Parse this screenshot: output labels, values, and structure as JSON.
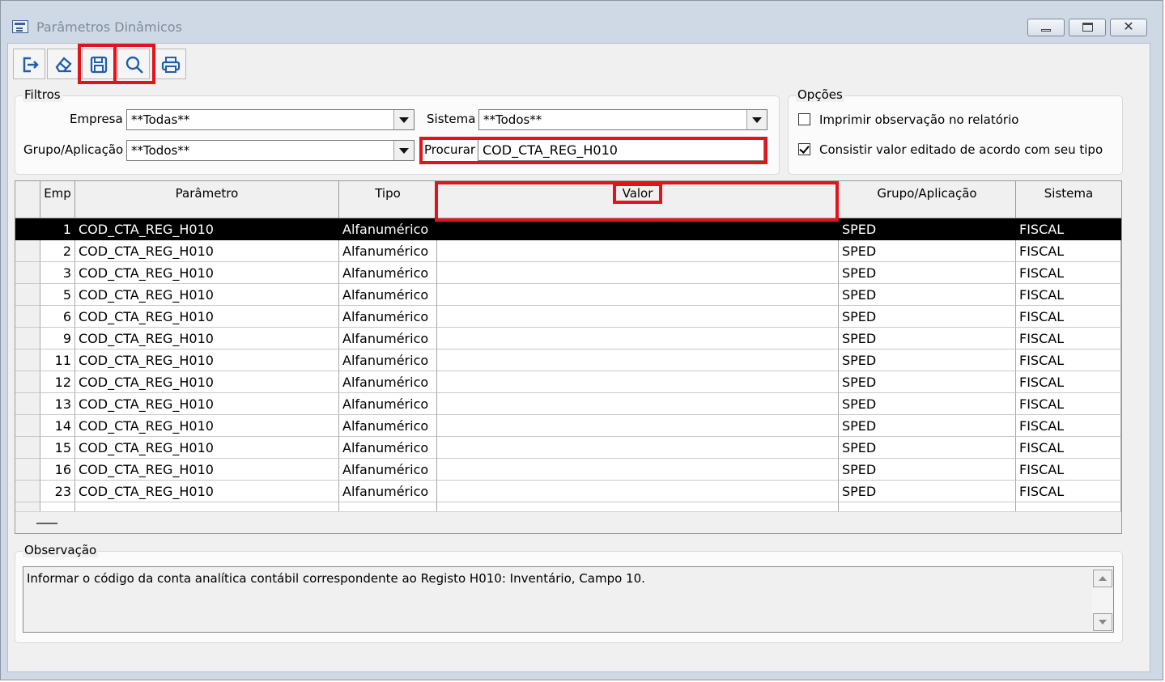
{
  "window": {
    "title": "Parâmetros Dinâmicos",
    "close_glyph": "✕"
  },
  "toolbar": {
    "buttons": [
      {
        "icon": "exit-icon"
      },
      {
        "icon": "eraser-icon"
      },
      {
        "icon": "save-icon"
      },
      {
        "icon": "search-icon"
      },
      {
        "icon": "printer-icon"
      }
    ]
  },
  "filters": {
    "legend": "Filtros",
    "empresa_label": "Empresa",
    "empresa_value": "**Todas**",
    "sistema_label": "Sistema",
    "sistema_value": "**Todos**",
    "grupo_label": "Grupo/Aplicação",
    "grupo_value": "**Todos**",
    "procurar_label": "Procurar",
    "procurar_value": "COD_CTA_REG_H010"
  },
  "options": {
    "legend": "Opções",
    "imprimir_label": "Imprimir observação no relatório",
    "imprimir_checked": false,
    "consistir_label": "Consistir valor editado de acordo com seu tipo",
    "consistir_checked": true
  },
  "grid": {
    "columns": [
      "Emp",
      "Parâmetro",
      "Tipo",
      "Valor",
      "Grupo/Aplicação",
      "Sistema"
    ],
    "selected_row": 0,
    "rows": [
      {
        "emp": "1",
        "parametro": "COD_CTA_REG_H010",
        "tipo": "Alfanumérico",
        "valor": "",
        "grupo": "SPED",
        "sistema": "FISCAL"
      },
      {
        "emp": "2",
        "parametro": "COD_CTA_REG_H010",
        "tipo": "Alfanumérico",
        "valor": "",
        "grupo": "SPED",
        "sistema": "FISCAL"
      },
      {
        "emp": "3",
        "parametro": "COD_CTA_REG_H010",
        "tipo": "Alfanumérico",
        "valor": "",
        "grupo": "SPED",
        "sistema": "FISCAL"
      },
      {
        "emp": "5",
        "parametro": "COD_CTA_REG_H010",
        "tipo": "Alfanumérico",
        "valor": "",
        "grupo": "SPED",
        "sistema": "FISCAL"
      },
      {
        "emp": "6",
        "parametro": "COD_CTA_REG_H010",
        "tipo": "Alfanumérico",
        "valor": "",
        "grupo": "SPED",
        "sistema": "FISCAL"
      },
      {
        "emp": "9",
        "parametro": "COD_CTA_REG_H010",
        "tipo": "Alfanumérico",
        "valor": "",
        "grupo": "SPED",
        "sistema": "FISCAL"
      },
      {
        "emp": "11",
        "parametro": "COD_CTA_REG_H010",
        "tipo": "Alfanumérico",
        "valor": "",
        "grupo": "SPED",
        "sistema": "FISCAL"
      },
      {
        "emp": "12",
        "parametro": "COD_CTA_REG_H010",
        "tipo": "Alfanumérico",
        "valor": "",
        "grupo": "SPED",
        "sistema": "FISCAL"
      },
      {
        "emp": "13",
        "parametro": "COD_CTA_REG_H010",
        "tipo": "Alfanumérico",
        "valor": "",
        "grupo": "SPED",
        "sistema": "FISCAL"
      },
      {
        "emp": "14",
        "parametro": "COD_CTA_REG_H010",
        "tipo": "Alfanumérico",
        "valor": "",
        "grupo": "SPED",
        "sistema": "FISCAL"
      },
      {
        "emp": "15",
        "parametro": "COD_CTA_REG_H010",
        "tipo": "Alfanumérico",
        "valor": "",
        "grupo": "SPED",
        "sistema": "FISCAL"
      },
      {
        "emp": "16",
        "parametro": "COD_CTA_REG_H010",
        "tipo": "Alfanumérico",
        "valor": "",
        "grupo": "SPED",
        "sistema": "FISCAL"
      },
      {
        "emp": "23",
        "parametro": "COD_CTA_REG_H010",
        "tipo": "Alfanumérico",
        "valor": "",
        "grupo": "SPED",
        "sistema": "FISCAL"
      }
    ]
  },
  "observacao": {
    "legend": "Observação",
    "text": "Informar o código da conta analítica contábil correspondente ao Registo H010: Inventário, Campo 10."
  },
  "colors": {
    "highlight": "#e0141d",
    "selection_bg": "#000000",
    "selection_fg": "#ffffff",
    "window_frame": "#cfd9e6"
  }
}
